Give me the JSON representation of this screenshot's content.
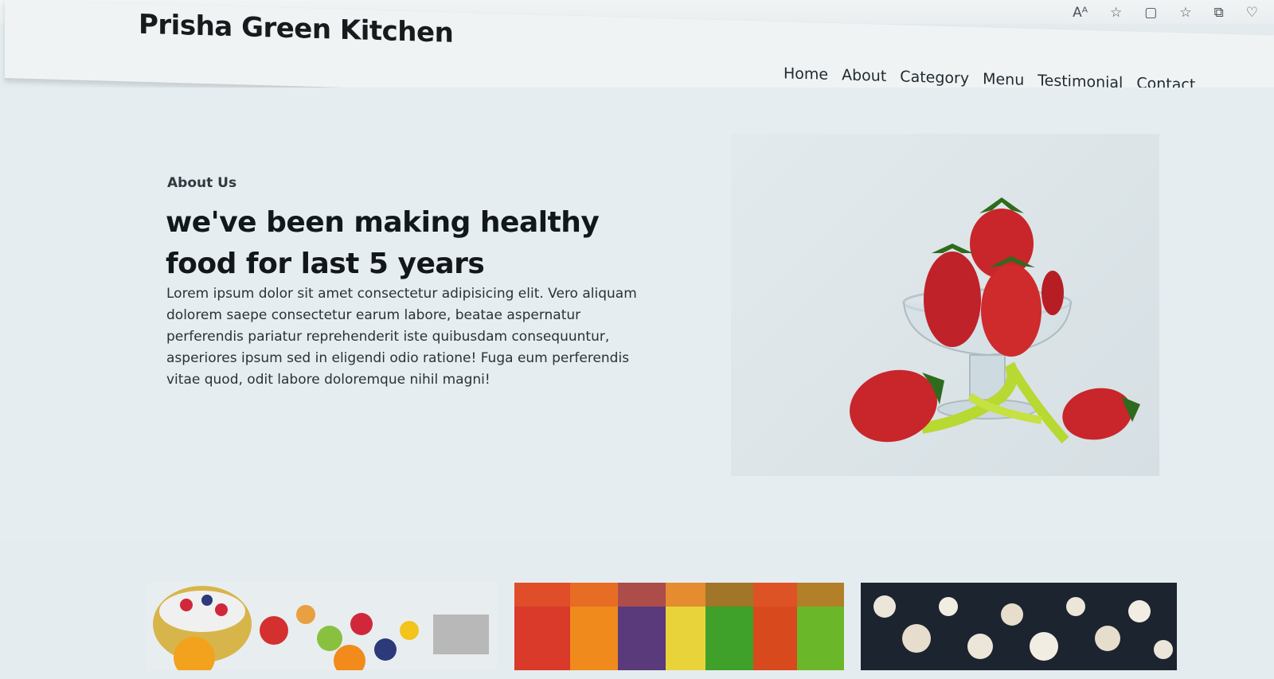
{
  "browser": {
    "icons": [
      "read-aloud-icon",
      "favorite-star-icon",
      "reading-view-icon",
      "favorites-list-icon",
      "collections-icon",
      "extensions-icon"
    ],
    "glyphs": [
      "Aᴬ",
      "☆",
      "▢",
      "☆",
      "⧉",
      "♡"
    ]
  },
  "header": {
    "brand": "Prisha Green Kitchen",
    "nav": [
      "Home",
      "About",
      "Category",
      "Menu",
      "Testimonial",
      "Contact"
    ]
  },
  "about": {
    "label": "About Us",
    "title": "we've been making healthy food for last 5 years",
    "text": "Lorem ipsum dolor sit amet consectetur adipisicing elit. Vero aliquam dolorem saepe consectetur earum labore, beatae aspernatur perferendis pariatur reprehenderit iste quibusdam consequuntur, asperiores ipsum sed in eligendi odio ratione! Fuga eum perferendis vitae quod, odit labore doloremque nihil magni!"
  },
  "colors": {
    "background": "#e6edf0",
    "text": "#12171a",
    "strawberry": "#c8262a",
    "ribbon": "#b8d832"
  }
}
